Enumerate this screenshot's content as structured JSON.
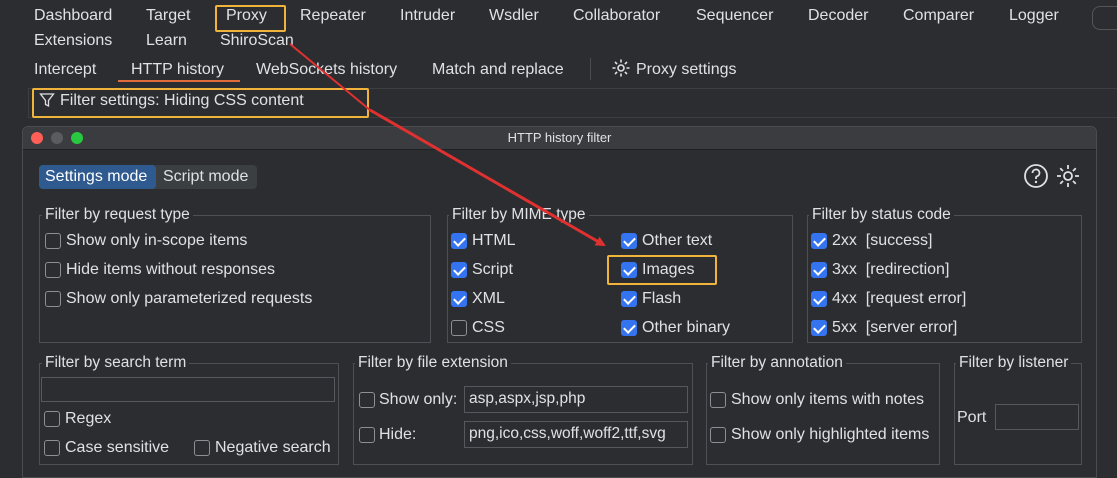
{
  "top_tabs": [
    "Dashboard",
    "Target",
    "Proxy",
    "Repeater",
    "Intruder",
    "Wsdler",
    "Collaborator",
    "Sequencer",
    "Decoder",
    "Comparer",
    "Logger"
  ],
  "top_tabs_row2": [
    "Extensions",
    "Learn",
    "ShiroScan"
  ],
  "sub_tabs": [
    "Intercept",
    "HTTP history",
    "WebSockets history",
    "Match and replace"
  ],
  "proxy_settings_label": "Proxy settings",
  "filter_settings_label": "Filter settings: Hiding CSS content",
  "dialog": {
    "title": "HTTP history filter",
    "mode_settings": "Settings mode",
    "mode_script": "Script mode",
    "request_type": {
      "legend": "Filter by request type",
      "items": [
        {
          "label": "Show only in-scope items",
          "checked": false
        },
        {
          "label": "Hide items without responses",
          "checked": false
        },
        {
          "label": "Show only parameterized requests",
          "checked": false
        }
      ]
    },
    "mime_type": {
      "legend": "Filter by MIME type",
      "col1": [
        {
          "label": "HTML",
          "checked": true
        },
        {
          "label": "Script",
          "checked": true
        },
        {
          "label": "XML",
          "checked": true
        },
        {
          "label": "CSS",
          "checked": false
        }
      ],
      "col2": [
        {
          "label": "Other text",
          "checked": true
        },
        {
          "label": "Images",
          "checked": true
        },
        {
          "label": "Flash",
          "checked": true
        },
        {
          "label": "Other binary",
          "checked": true
        }
      ]
    },
    "status_code": {
      "legend": "Filter by status code",
      "items": [
        {
          "label": "2xx  [success]",
          "checked": true
        },
        {
          "label": "3xx  [redirection]",
          "checked": true
        },
        {
          "label": "4xx  [request error]",
          "checked": true
        },
        {
          "label": "5xx  [server error]",
          "checked": true
        }
      ]
    },
    "search_term": {
      "legend": "Filter by search term",
      "value": "",
      "regex": "Regex",
      "case_sensitive": "Case sensitive",
      "negative_search": "Negative search"
    },
    "file_extension": {
      "legend": "Filter by file extension",
      "show_only_label": "Show only:",
      "show_only_value": "asp,aspx,jsp,php",
      "hide_label": "Hide:",
      "hide_value": "png,ico,css,woff,woff2,ttf,svg"
    },
    "annotation": {
      "legend": "Filter by annotation",
      "notes": "Show only items with notes",
      "highlighted": "Show only highlighted items"
    },
    "listener": {
      "legend": "Filter by listener",
      "port_label": "Port",
      "port_value": ""
    }
  },
  "colors": {
    "accent": "#3574f0",
    "highlight": "#f0b43c",
    "arrow": "#e03131"
  }
}
